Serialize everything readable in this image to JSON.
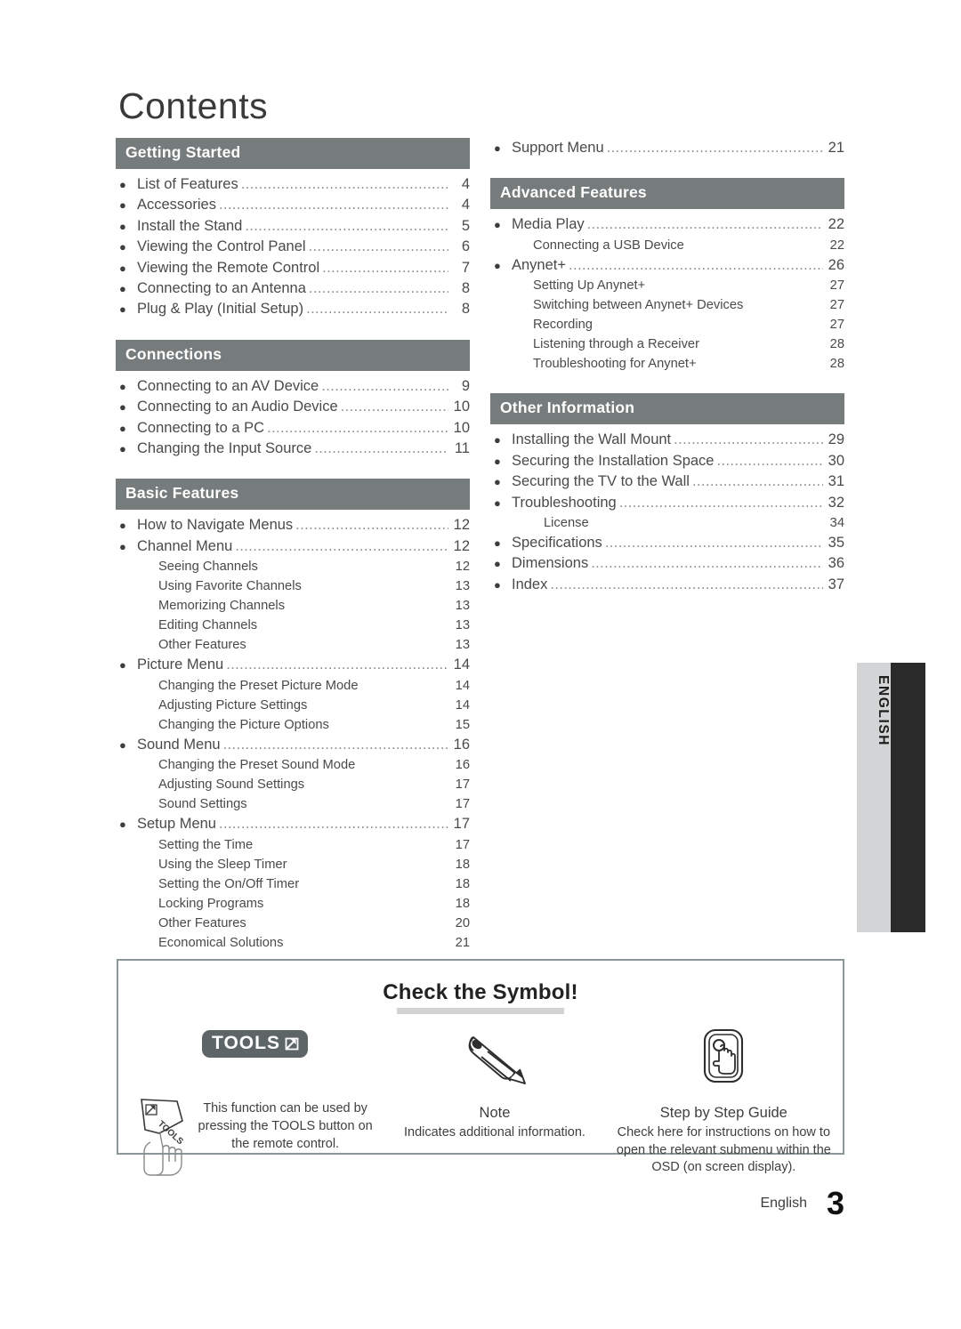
{
  "page": {
    "title": "Contents",
    "footer_label": "English",
    "footer_page": "3",
    "side_tab_label": "ENGLISH",
    "accent_bar_color": "#767c7c",
    "side_tab_light_color": "#d2d4d5",
    "side_tab_dark_color": "#2b2a2a"
  },
  "left_column": [
    {
      "header": "Getting Started",
      "entries": [
        {
          "level": "main",
          "title": "List of Features",
          "page": "4"
        },
        {
          "level": "main",
          "title": "Accessories",
          "page": "4"
        },
        {
          "level": "main",
          "title": "Install the Stand",
          "page": "5"
        },
        {
          "level": "main",
          "title": "Viewing the Control Panel",
          "page": "6"
        },
        {
          "level": "main",
          "title": "Viewing the Remote Control",
          "page": "7"
        },
        {
          "level": "main",
          "title": "Connecting to an Antenna",
          "page": "8"
        },
        {
          "level": "main",
          "title": "Plug & Play (Initial Setup)",
          "page": "8"
        }
      ]
    },
    {
      "header": "Connections",
      "entries": [
        {
          "level": "main",
          "title": "Connecting to an AV Device",
          "page": "9"
        },
        {
          "level": "main",
          "title": "Connecting to an Audio Device",
          "page": "10"
        },
        {
          "level": "main",
          "title": "Connecting to a PC",
          "page": "10"
        },
        {
          "level": "main",
          "title": "Changing the Input Source",
          "page": "11"
        }
      ]
    },
    {
      "header": "Basic Features",
      "entries": [
        {
          "level": "main",
          "title": "How to Navigate Menus",
          "page": "12"
        },
        {
          "level": "main",
          "title": "Channel Menu",
          "page": "12"
        },
        {
          "level": "sub",
          "title": "Seeing Channels",
          "page": "12"
        },
        {
          "level": "sub",
          "title": "Using Favorite Channels",
          "page": "13"
        },
        {
          "level": "sub",
          "title": "Memorizing Channels",
          "page": "13"
        },
        {
          "level": "sub",
          "title": "Editing Channels",
          "page": "13"
        },
        {
          "level": "sub",
          "title": "Other Features",
          "page": "13"
        },
        {
          "level": "main",
          "title": "Picture Menu",
          "page": "14"
        },
        {
          "level": "sub",
          "title": "Changing the Preset Picture Mode",
          "page": "14"
        },
        {
          "level": "sub",
          "title": "Adjusting Picture Settings",
          "page": "14"
        },
        {
          "level": "sub",
          "title": "Changing the Picture Options",
          "page": "15"
        },
        {
          "level": "main",
          "title": "Sound Menu",
          "page": "16"
        },
        {
          "level": "sub",
          "title": "Changing the Preset Sound Mode",
          "page": "16"
        },
        {
          "level": "sub",
          "title": "Adjusting Sound Settings",
          "page": "17"
        },
        {
          "level": "sub",
          "title": "Sound Settings",
          "page": "17"
        },
        {
          "level": "main",
          "title": "Setup Menu",
          "page": "17"
        },
        {
          "level": "sub",
          "title": "Setting the Time",
          "page": "17"
        },
        {
          "level": "sub",
          "title": "Using the Sleep Timer",
          "page": "18"
        },
        {
          "level": "sub",
          "title": "Setting the On/Off Timer",
          "page": "18"
        },
        {
          "level": "sub",
          "title": "Locking Programs",
          "page": "18"
        },
        {
          "level": "sub",
          "title": "Other Features",
          "page": "20"
        },
        {
          "level": "sub",
          "title": "Economical Solutions",
          "page": "21"
        }
      ]
    }
  ],
  "right_column": [
    {
      "header": null,
      "entries": [
        {
          "level": "main",
          "title": "Support Menu",
          "page": "21"
        }
      ]
    },
    {
      "header": "Advanced Features",
      "entries": [
        {
          "level": "main",
          "title": "Media Play",
          "page": "22"
        },
        {
          "level": "sub",
          "title": "Connecting a USB Device",
          "page": "22"
        },
        {
          "level": "main",
          "title": "Anynet+",
          "page": "26"
        },
        {
          "level": "sub",
          "title": "Setting Up Anynet+",
          "page": "27"
        },
        {
          "level": "sub",
          "title": "Switching between Anynet+ Devices",
          "page": "27"
        },
        {
          "level": "sub",
          "title": "Recording",
          "page": "27"
        },
        {
          "level": "sub",
          "title": "Listening through a Receiver",
          "page": "28"
        },
        {
          "level": "sub",
          "title": "Troubleshooting for Anynet+",
          "page": "28"
        }
      ]
    },
    {
      "header": "Other Information",
      "entries": [
        {
          "level": "main",
          "title": "Installing the Wall Mount",
          "page": "29"
        },
        {
          "level": "main",
          "title": "Securing the Installation Space",
          "page": "30"
        },
        {
          "level": "main",
          "title": "Securing the TV to the Wall",
          "page": "31"
        },
        {
          "level": "main",
          "title": "Troubleshooting",
          "page": "32"
        },
        {
          "level": "sub-deep",
          "title": "License",
          "page": "34"
        },
        {
          "level": "main",
          "title": "Specifications",
          "page": "35"
        },
        {
          "level": "main",
          "title": "Dimensions",
          "page": "36"
        },
        {
          "level": "main",
          "title": "Index",
          "page": "37"
        }
      ]
    }
  ],
  "symbol_box": {
    "title": "Check the Symbol!",
    "items": [
      {
        "icon": "tools-badge-icon",
        "badge_label": "TOOLS",
        "caption_head": "",
        "caption_body": "This function can be used by pressing the TOOLS button on the remote control."
      },
      {
        "icon": "pencil-icon",
        "badge_label": "",
        "caption_head": "Note",
        "caption_body": "Indicates additional information."
      },
      {
        "icon": "hand-press-button-icon",
        "badge_label": "",
        "caption_head": "Step by Step Guide",
        "caption_body": "Check here for instructions on how to open the relevant submenu within the OSD (on screen display)."
      }
    ]
  }
}
